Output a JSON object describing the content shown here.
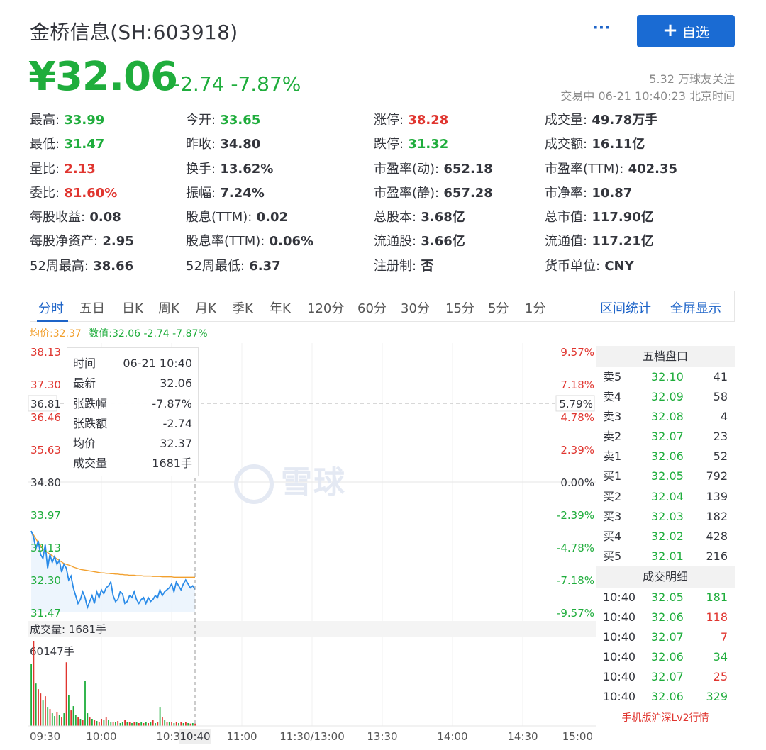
{
  "header": {
    "title": "金桥信息(SH:603918)",
    "more_label": "···",
    "follow_label": "自选",
    "follow_plus": "+",
    "price": "¥32.06",
    "change": "-2.74 -7.87%",
    "followers": "5.32 万球友关注",
    "status": "交易中 06-21 10:40:23 北京时间"
  },
  "colors": {
    "up": "#e0352f",
    "down": "#1fad3c",
    "accent": "#1a6bd3",
    "avg_line": "#f2a02e",
    "price_line": "#2a8be8"
  },
  "quote_rows": [
    [
      {
        "label": "最高:",
        "value": "33.99",
        "tone": "green"
      },
      {
        "label": "今开:",
        "value": "33.65",
        "tone": "green"
      },
      {
        "label": "涨停:",
        "value": "38.28",
        "tone": "red"
      },
      {
        "label": "成交量:",
        "value": "49.78万手",
        "tone": "plain"
      }
    ],
    [
      {
        "label": "最低:",
        "value": "31.47",
        "tone": "green"
      },
      {
        "label": "昨收:",
        "value": "34.80",
        "tone": "plain"
      },
      {
        "label": "跌停:",
        "value": "31.32",
        "tone": "green"
      },
      {
        "label": "成交额:",
        "value": "16.11亿",
        "tone": "plain"
      }
    ],
    [
      {
        "label": "量比:",
        "value": "2.13",
        "tone": "red"
      },
      {
        "label": "换手:",
        "value": "13.62%",
        "tone": "plain"
      },
      {
        "label": "市盈率(动):",
        "value": "652.18",
        "tone": "plain"
      },
      {
        "label": "市盈率(TTM):",
        "value": "402.35",
        "tone": "plain"
      }
    ],
    [
      {
        "label": "委比:",
        "value": "81.60%",
        "tone": "red"
      },
      {
        "label": "振幅:",
        "value": "7.24%",
        "tone": "plain"
      },
      {
        "label": "市盈率(静):",
        "value": "657.28",
        "tone": "plain"
      },
      {
        "label": "市净率:",
        "value": "10.87",
        "tone": "plain"
      }
    ],
    [
      {
        "label": "每股收益:",
        "value": "0.08",
        "tone": "plain"
      },
      {
        "label": "股息(TTM):",
        "value": "0.02",
        "tone": "plain"
      },
      {
        "label": "总股本:",
        "value": "3.68亿",
        "tone": "plain"
      },
      {
        "label": "总市值:",
        "value": "117.90亿",
        "tone": "plain"
      }
    ],
    [
      {
        "label": "每股净资产:",
        "value": "2.95",
        "tone": "plain"
      },
      {
        "label": "股息率(TTM):",
        "value": "0.06%",
        "tone": "plain"
      },
      {
        "label": "流通股:",
        "value": "3.66亿",
        "tone": "plain"
      },
      {
        "label": "流通值:",
        "value": "117.21亿",
        "tone": "plain"
      }
    ],
    [
      {
        "label": "52周最高:",
        "value": "38.66",
        "tone": "plain"
      },
      {
        "label": "52周最低:",
        "value": "6.37",
        "tone": "plain"
      },
      {
        "label": "注册制:",
        "value": "否",
        "tone": "plain"
      },
      {
        "label": "货币单位:",
        "value": "CNY",
        "tone": "plain"
      }
    ]
  ],
  "tabs": [
    "分时",
    "五日",
    "日K",
    "周K",
    "月K",
    "季K",
    "年K",
    "120分",
    "60分",
    "30分",
    "15分",
    "5分",
    "1分"
  ],
  "active_tab": 0,
  "tab_links": [
    "区间统计",
    "全屏显示"
  ],
  "avg_info": {
    "avg": "均价:32.37",
    "cur": "数值:32.06 -2.74 -7.87%"
  },
  "watermark": "雪球",
  "tooltip": [
    {
      "k": "时间",
      "v": "06-21 10:40",
      "tone": "plain"
    },
    {
      "k": "最新",
      "v": "32.06",
      "tone": "green"
    },
    {
      "k": "张跌幅",
      "v": "-7.87%",
      "tone": "green"
    },
    {
      "k": "张跌额",
      "v": "-2.74",
      "tone": "green"
    },
    {
      "k": "均价",
      "v": "32.37",
      "tone": "green"
    },
    {
      "k": "成交量",
      "v": "1681手",
      "tone": "plain"
    }
  ],
  "chart_data": {
    "type": "line",
    "prev_close": 34.8,
    "y_left_ticks": [
      "38.13",
      "37.30",
      "36.46",
      "35.63",
      "34.80",
      "33.97",
      "33.13",
      "32.30",
      "31.47"
    ],
    "y_right_ticks": [
      "9.57%",
      "7.18%",
      "4.78%",
      "2.39%",
      "0.00%",
      "-2.39%",
      "-4.78%",
      "-7.18%",
      "-9.57%"
    ],
    "ylim": [
      31.47,
      38.13
    ],
    "crosshair_price": "36.81",
    "crosshair_pct": "5.79%",
    "x_ticks": [
      "09:30",
      "10:00",
      "10:30",
      "11:00",
      "11:30/13:00",
      "13:30",
      "14:00",
      "14:30",
      "15:00"
    ],
    "cursor_time": "10:40",
    "cursor_minute": 70,
    "total_minutes": 240,
    "series": [
      {
        "name": "",
        "values": [
          33.55,
          33.4,
          33.1,
          33.3,
          32.95,
          32.85,
          33.2,
          32.6,
          32.95,
          32.75,
          32.9,
          32.7,
          32.8,
          32.5,
          32.7,
          32.6,
          32.3,
          32.4,
          32.1,
          31.9,
          31.7,
          31.8,
          32.0,
          31.85,
          31.6,
          31.75,
          31.9,
          31.7,
          32.0,
          31.85,
          32.05,
          31.95,
          32.1,
          32.15,
          32.25,
          31.9,
          31.75,
          31.8,
          32.0,
          31.95,
          31.7,
          31.75,
          31.9,
          31.85,
          32.0,
          31.8,
          31.7,
          31.8,
          31.85,
          31.7,
          31.85,
          31.75,
          31.8,
          31.9,
          31.85,
          32.05,
          31.9,
          32.0,
          32.05,
          32.1,
          32.2,
          32.0,
          32.25,
          32.15,
          32.05,
          32.2,
          32.3,
          32.2,
          32.1,
          32.15,
          32.06
        ]
      },
      {
        "name": "",
        "values": [
          33.55,
          33.45,
          33.35,
          33.25,
          33.18,
          33.1,
          33.05,
          33.0,
          32.96,
          32.92,
          32.88,
          32.84,
          32.8,
          32.76,
          32.72,
          32.7,
          32.68,
          32.66,
          32.63,
          32.61,
          32.59,
          32.57,
          32.56,
          32.55,
          32.54,
          32.53,
          32.52,
          32.51,
          32.5,
          32.49,
          32.48,
          32.48,
          32.47,
          32.47,
          32.46,
          32.46,
          32.45,
          32.45,
          32.44,
          32.44,
          32.43,
          32.43,
          32.42,
          32.42,
          32.42,
          32.41,
          32.41,
          32.41,
          32.4,
          32.4,
          32.4,
          32.4,
          32.39,
          32.39,
          32.39,
          32.39,
          32.38,
          32.38,
          32.38,
          32.38,
          32.38,
          32.37,
          32.37,
          32.37,
          32.37,
          32.37,
          32.37,
          32.37,
          32.37,
          32.37,
          32.37
        ]
      }
    ],
    "volume_label": "成交量: 1681手",
    "volume_max_label": "60147手",
    "volume_max": 60147,
    "volumes": [
      44000,
      60147,
      30000,
      26000,
      23000,
      18000,
      21000,
      13000,
      12000,
      9000,
      7000,
      10000,
      8000,
      6000,
      9000,
      45000,
      22000,
      11000,
      14000,
      8000,
      6000,
      5000,
      4000,
      32000,
      9000,
      6000,
      5000,
      4000,
      3500,
      3000,
      5000,
      4000,
      6000,
      4500,
      3000,
      2500,
      3000,
      3500,
      2000,
      2500,
      4000,
      3000,
      2500,
      2000,
      3000,
      2500,
      2000,
      2500,
      2000,
      3000,
      2000,
      2500,
      4000,
      2000,
      2500,
      13000,
      6000,
      4000,
      3000,
      2500,
      3000,
      2000,
      2500,
      2000,
      3000,
      2000,
      2500,
      2000,
      1681,
      2000,
      1681
    ],
    "volume_up": [
      0,
      1,
      0,
      1,
      1,
      0,
      1,
      0,
      1,
      0,
      0,
      1,
      0,
      1,
      0,
      1,
      0,
      1,
      0,
      0,
      1,
      0,
      1,
      0,
      0,
      1,
      0,
      1,
      0,
      1,
      1,
      0,
      1,
      0,
      0,
      1,
      0,
      1,
      0,
      0,
      1,
      0,
      1,
      0,
      1,
      0,
      1,
      0,
      1,
      0,
      1,
      0,
      1,
      0,
      1,
      0,
      1,
      0,
      1,
      0,
      1,
      0,
      1,
      0,
      1,
      0,
      1,
      0,
      1,
      0,
      1
    ]
  },
  "order_book": {
    "title": "五档盘口",
    "rows": [
      {
        "side": "卖5",
        "price": "32.10",
        "qty": "41"
      },
      {
        "side": "卖4",
        "price": "32.09",
        "qty": "58"
      },
      {
        "side": "卖3",
        "price": "32.08",
        "qty": "4"
      },
      {
        "side": "卖2",
        "price": "32.07",
        "qty": "23"
      },
      {
        "side": "卖1",
        "price": "32.06",
        "qty": "52"
      },
      {
        "side": "买1",
        "price": "32.05",
        "qty": "792"
      },
      {
        "side": "买2",
        "price": "32.04",
        "qty": "139"
      },
      {
        "side": "买3",
        "price": "32.03",
        "qty": "182"
      },
      {
        "side": "买4",
        "price": "32.02",
        "qty": "428"
      },
      {
        "side": "买5",
        "price": "32.01",
        "qty": "216"
      }
    ],
    "trades_title": "成交明细",
    "trades": [
      {
        "time": "10:40",
        "price": "32.05",
        "qty": "181",
        "tone": "green"
      },
      {
        "time": "10:40",
        "price": "32.06",
        "qty": "118",
        "tone": "red"
      },
      {
        "time": "10:40",
        "price": "32.07",
        "qty": "7",
        "tone": "red"
      },
      {
        "time": "10:40",
        "price": "32.06",
        "qty": "34",
        "tone": "green"
      },
      {
        "time": "10:40",
        "price": "32.07",
        "qty": "25",
        "tone": "red"
      },
      {
        "time": "10:40",
        "price": "32.06",
        "qty": "329",
        "tone": "green"
      }
    ],
    "lv2_link": "手机版沪深Lv2行情"
  }
}
